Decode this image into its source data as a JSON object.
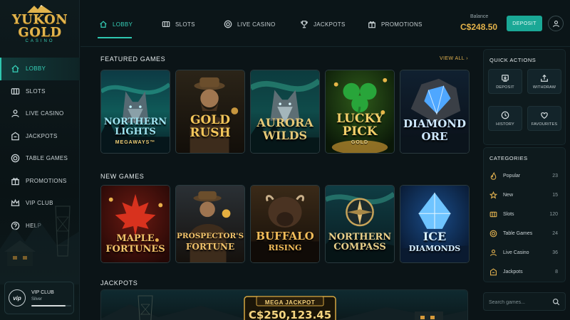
{
  "brand": {
    "line1": "YUKON",
    "line2": "GOLD",
    "sub": "CASINO"
  },
  "nav": {
    "items": [
      {
        "label": "LOBBY",
        "icon": "home-icon"
      },
      {
        "label": "SLOTS",
        "icon": "slots-icon"
      },
      {
        "label": "LIVE CASINO",
        "icon": "user-icon"
      },
      {
        "label": "JACKPOTS",
        "icon": "jackpot-icon"
      },
      {
        "label": "TABLE GAMES",
        "icon": "chip-icon"
      },
      {
        "label": "PROMOTIONS",
        "icon": "gift-icon"
      },
      {
        "label": "VIP CLUB",
        "icon": "crown-icon"
      },
      {
        "label": "HELP",
        "icon": "help-icon"
      }
    ]
  },
  "vip": {
    "badge": "vip",
    "title": "VIP CLUB",
    "tier": "Silver",
    "progress": 0.85
  },
  "topbar": {
    "tabs": [
      {
        "label": "LOBBY",
        "icon": "home-icon"
      },
      {
        "label": "SLOTS",
        "icon": "slots-icon"
      },
      {
        "label": "LIVE CASINO",
        "icon": "chip-icon"
      },
      {
        "label": "JACKPOTS",
        "icon": "trophy-icon"
      },
      {
        "label": "PROMOTIONS",
        "icon": "gift-icon"
      }
    ],
    "balance_label": "Balance",
    "balance_value": "C$248.50",
    "deposit_label": "DEPOSIT"
  },
  "featured": {
    "title": "FEATURED GAMES",
    "view_all": "VIEW ALL",
    "games": [
      {
        "line1": "NORTHERN",
        "line2": "LIGHTS",
        "sub": "MEGAWAYS™",
        "accent": "#9fe3f0"
      },
      {
        "line1": "GOLD",
        "line2": "RUSH",
        "sub": "",
        "accent": "#f2c55a"
      },
      {
        "line1": "AURORA",
        "line2": "WILDS",
        "sub": "",
        "accent": "#e6c978"
      },
      {
        "line1": "LUCKY",
        "line2": "PICK",
        "sub": "GOLD",
        "accent": "#f3cf6a"
      },
      {
        "line1": "DIAMOND",
        "line2": "ORE",
        "sub": "",
        "accent": "#cfe9ff"
      }
    ]
  },
  "new_games": {
    "title": "NEW GAMES",
    "games": [
      {
        "line1": "MAPLE",
        "line2": "FORTUNES",
        "accent": "#f3c46a"
      },
      {
        "line1": "PROSPECTOR'S",
        "line2": "FORTUNE",
        "accent": "#f1c36b"
      },
      {
        "line1": "BUFFALO",
        "line2": "RISING",
        "accent": "#f3bd5a"
      },
      {
        "line1": "NORTHERN",
        "line2": "COMPASS",
        "accent": "#e9cf8a"
      },
      {
        "line1": "ICE",
        "line2": "DIAMONDS",
        "accent": "#d7efff"
      }
    ]
  },
  "jackpots": {
    "title": "JACKPOTS",
    "mega_label": "MEGA JACKPOT",
    "mega_value": "C$250,123.45"
  },
  "quick_actions": {
    "title": "QUICK ACTIONS",
    "items": [
      {
        "label": "DEPOSIT",
        "icon": "deposit-icon"
      },
      {
        "label": "WITHDRAW",
        "icon": "withdraw-icon"
      },
      {
        "label": "HISTORY",
        "icon": "history-icon"
      },
      {
        "label": "FAVOURITES",
        "icon": "heart-icon"
      }
    ]
  },
  "categories": {
    "title": "CATEGORIES",
    "items": [
      {
        "label": "Popular",
        "count": "23",
        "icon": "flame-icon"
      },
      {
        "label": "New",
        "count": "15",
        "icon": "star-icon"
      },
      {
        "label": "Slots",
        "count": "120",
        "icon": "slots-icon"
      },
      {
        "label": "Table Games",
        "count": "24",
        "icon": "chip-icon"
      },
      {
        "label": "Live Casino",
        "count": "36",
        "icon": "user-icon"
      },
      {
        "label": "Jackpots",
        "count": "8",
        "icon": "jackpot-icon"
      }
    ]
  },
  "search": {
    "placeholder": "Search games..."
  },
  "colors": {
    "accent": "#2ec7b0",
    "gold": "#e3b24a",
    "bg": "#0b1417"
  }
}
